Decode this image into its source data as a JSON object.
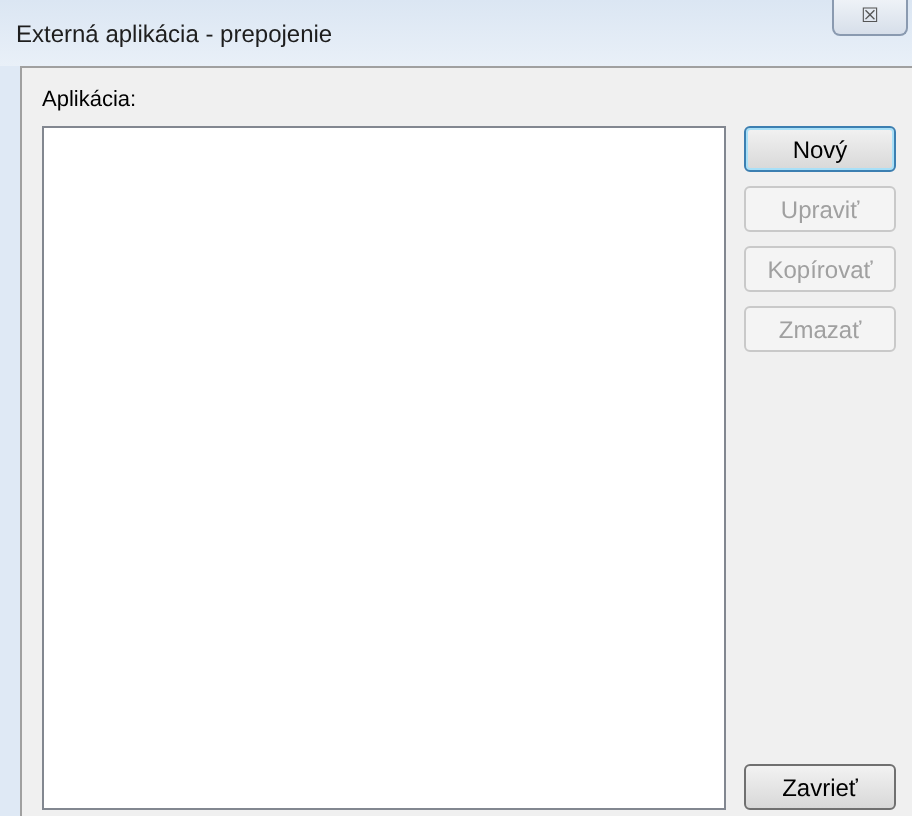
{
  "window": {
    "title": "Externá aplikácia - prepojenie",
    "close_icon": "☒"
  },
  "list": {
    "label": "Aplikácia:"
  },
  "buttons": [
    {
      "label": "Nový",
      "disabled": false,
      "focused": true
    },
    {
      "label": "Upraviť",
      "disabled": true,
      "focused": false
    },
    {
      "label": "Kopírovať",
      "disabled": true,
      "focused": false
    },
    {
      "label": "Zmazať",
      "disabled": true,
      "focused": false
    }
  ],
  "footer_buttons": [
    {
      "label": "Zavrieť",
      "disabled": false,
      "focused": false
    }
  ]
}
